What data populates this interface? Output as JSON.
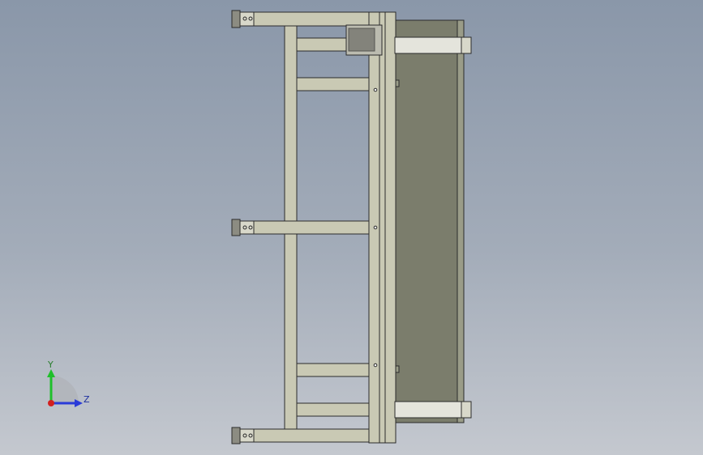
{
  "viewport": {
    "background_top": "#8a97a9",
    "background_bottom": "#c4c8cf",
    "frame_color": "#c9c9b4",
    "frame_edge": "#2b2b2b",
    "belt_color": "#7b7d6c",
    "plate_color": "#e4e4dc"
  },
  "triad": {
    "x_label": "Y",
    "z_label": "Z",
    "y_color": "#1fbf2a",
    "z_color": "#2a3bd8",
    "x_color": "#d22020"
  }
}
